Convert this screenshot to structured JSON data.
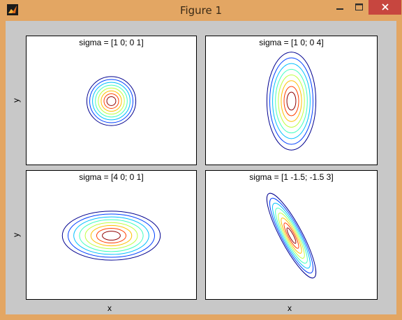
{
  "window": {
    "title": "Figure 1",
    "controls": [
      "minimize",
      "maximize",
      "close"
    ]
  },
  "colors": {
    "titlebar": "#e3a663",
    "close_button": "#c7463f",
    "client": "#c8c8c8",
    "contour_levels": [
      "#00008f",
      "#0040ff",
      "#00bfff",
      "#40ff bf",
      "#bfff40",
      "#ffbf00",
      "#ff4000",
      "#8f0000"
    ]
  },
  "axes_labels": {
    "y": "y",
    "x": "x"
  },
  "plots": [
    {
      "title": "sigma = [1 0; 0 1]",
      "sigma": [
        [
          1,
          0
        ],
        [
          0,
          1
        ]
      ]
    },
    {
      "title": "sigma = [1 0; 0 4]",
      "sigma": [
        [
          1,
          0
        ],
        [
          0,
          4
        ]
      ]
    },
    {
      "title": "sigma = [4 0; 0 1]",
      "sigma": [
        [
          4,
          0
        ],
        [
          0,
          1
        ]
      ]
    },
    {
      "title": "sigma = [1 -1.5; -1.5 3]",
      "sigma": [
        [
          1,
          -1.5
        ],
        [
          -1.5,
          3
        ]
      ]
    }
  ]
}
